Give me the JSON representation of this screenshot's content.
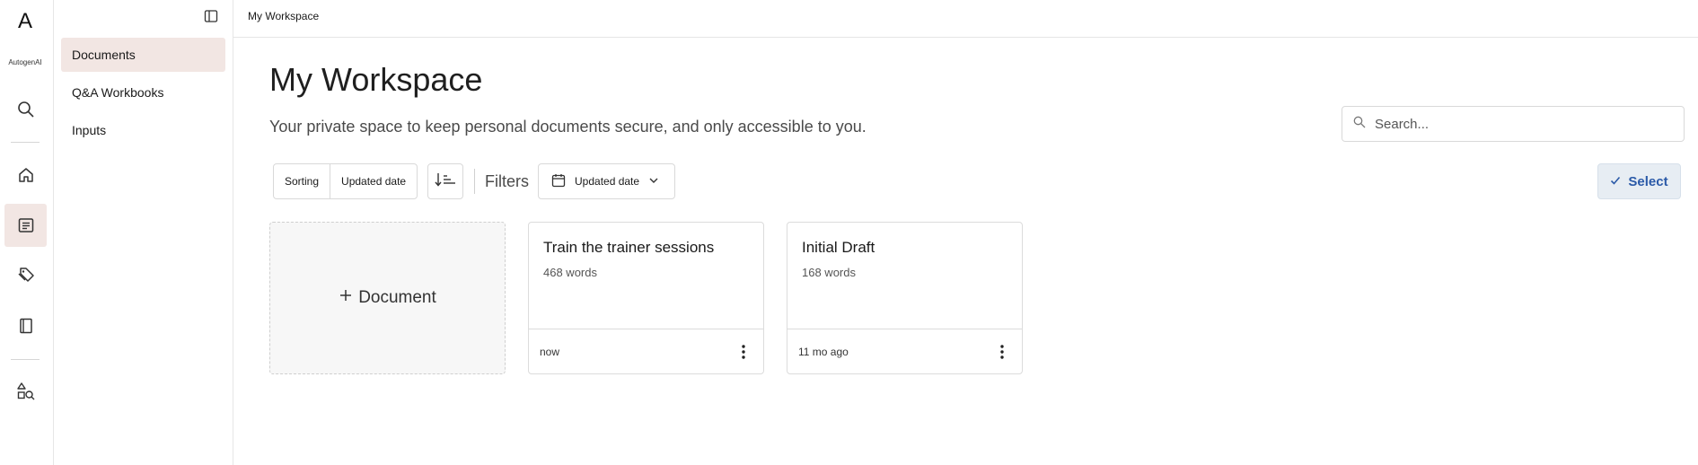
{
  "rail": {
    "logo": "A",
    "brand": "AutogenAI"
  },
  "sidebar": {
    "items": [
      {
        "label": "Documents"
      },
      {
        "label": "Q&A Workbooks"
      },
      {
        "label": "Inputs"
      }
    ]
  },
  "breadcrumb": "My Workspace",
  "page": {
    "title": "My Workspace",
    "subtitle": "Your private space to keep personal documents secure, and only accessible to you."
  },
  "search": {
    "placeholder": "Search..."
  },
  "toolbar": {
    "sorting_label": "Sorting",
    "sort_value": "Updated date",
    "filters_label": "Filters",
    "date_filter_label": "Updated date",
    "select_label": "Select"
  },
  "add_card": {
    "label": "Document"
  },
  "documents": [
    {
      "title": "Train the trainer sessions",
      "words": "468 words",
      "updated": "now"
    },
    {
      "title": "Initial Draft",
      "words": "168 words",
      "updated": "11 mo ago"
    }
  ],
  "colors": {
    "active_bg": "#f2e6e3",
    "select_text": "#2b5aa8",
    "select_bg": "#e7edf3"
  }
}
